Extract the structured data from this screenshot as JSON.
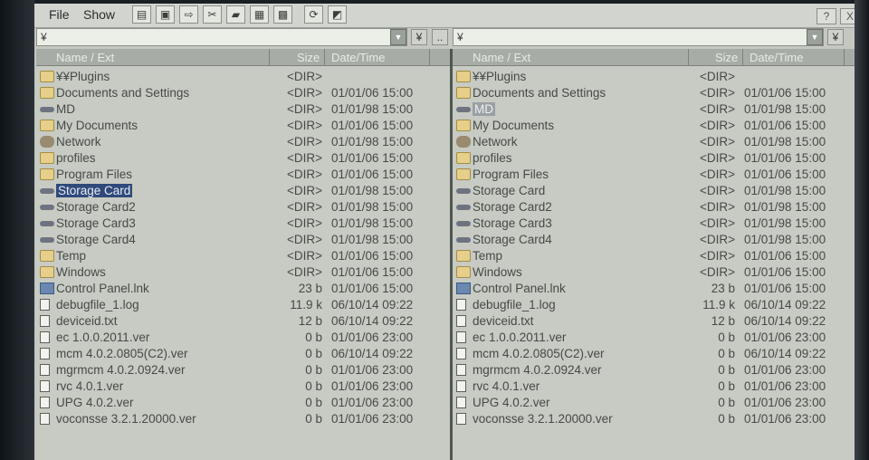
{
  "menu": {
    "file": "File",
    "show": "Show"
  },
  "toolbar_icons": [
    "view-icon",
    "properties-icon",
    "copy-icon",
    "cut-icon",
    "new-folder-icon",
    "delete-icon",
    "grid-icon",
    "refresh-icon",
    "options-icon"
  ],
  "window_buttons": {
    "help": "?",
    "close": "X"
  },
  "left_path": "¥",
  "right_path": "¥",
  "swap_label": "..",
  "yen_button": "¥",
  "columns": {
    "name": "Name / Ext",
    "size": "Size",
    "date": "Date/Time"
  },
  "left_files": [
    {
      "icon": "folder",
      "name": "¥¥Plugins",
      "size": "<DIR>",
      "date": ""
    },
    {
      "icon": "folder",
      "name": "Documents and Settings",
      "size": "<DIR>",
      "date": "01/01/06 15:00"
    },
    {
      "icon": "drive",
      "name": "MD",
      "size": "<DIR>",
      "date": "01/01/98 15:00"
    },
    {
      "icon": "folder",
      "name": "My Documents",
      "size": "<DIR>",
      "date": "01/01/06 15:00"
    },
    {
      "icon": "network",
      "name": "Network",
      "size": "<DIR>",
      "date": "01/01/98 15:00"
    },
    {
      "icon": "folder",
      "name": "profiles",
      "size": "<DIR>",
      "date": "01/01/06 15:00"
    },
    {
      "icon": "folder",
      "name": "Program Files",
      "size": "<DIR>",
      "date": "01/01/06 15:00"
    },
    {
      "icon": "drive",
      "name": "Storage Card",
      "size": "<DIR>",
      "date": "01/01/98 15:00",
      "selected": true
    },
    {
      "icon": "drive",
      "name": "Storage Card2",
      "size": "<DIR>",
      "date": "01/01/98 15:00"
    },
    {
      "icon": "drive",
      "name": "Storage Card3",
      "size": "<DIR>",
      "date": "01/01/98 15:00"
    },
    {
      "icon": "drive",
      "name": "Storage Card4",
      "size": "<DIR>",
      "date": "01/01/98 15:00"
    },
    {
      "icon": "folder",
      "name": "Temp",
      "size": "<DIR>",
      "date": "01/01/06 15:00"
    },
    {
      "icon": "folder",
      "name": "Windows",
      "size": "<DIR>",
      "date": "01/01/06 15:00"
    },
    {
      "icon": "link",
      "name": "Control Panel.lnk",
      "size": "23 b",
      "date": "01/01/06 15:00"
    },
    {
      "icon": "file",
      "name": "debugfile_1.log",
      "size": "11.9 k",
      "date": "06/10/14 09:22"
    },
    {
      "icon": "file",
      "name": "deviceid.txt",
      "size": "12 b",
      "date": "06/10/14 09:22"
    },
    {
      "icon": "file",
      "name": "ec 1.0.0.2011.ver",
      "size": "0 b",
      "date": "01/01/06 23:00"
    },
    {
      "icon": "file",
      "name": "mcm 4.0.2.0805(C2).ver",
      "size": "0 b",
      "date": "06/10/14 09:22"
    },
    {
      "icon": "file",
      "name": "mgrmcm 4.0.2.0924.ver",
      "size": "0 b",
      "date": "01/01/06 23:00"
    },
    {
      "icon": "file",
      "name": "rvc 4.0.1.ver",
      "size": "0 b",
      "date": "01/01/06 23:00"
    },
    {
      "icon": "file",
      "name": "UPG 4.0.2.ver",
      "size": "0 b",
      "date": "01/01/06 23:00"
    },
    {
      "icon": "file",
      "name": "voconsse 3.2.1.20000.ver",
      "size": "0 b",
      "date": "01/01/06 23:00"
    }
  ],
  "right_files": [
    {
      "icon": "folder",
      "name": "¥¥Plugins",
      "size": "<DIR>",
      "date": ""
    },
    {
      "icon": "folder",
      "name": "Documents and Settings",
      "size": "<DIR>",
      "date": "01/01/06 15:00"
    },
    {
      "icon": "drive",
      "name": "MD",
      "size": "<DIR>",
      "date": "01/01/98 15:00",
      "highlighted": true
    },
    {
      "icon": "folder",
      "name": "My Documents",
      "size": "<DIR>",
      "date": "01/01/06 15:00"
    },
    {
      "icon": "network",
      "name": "Network",
      "size": "<DIR>",
      "date": "01/01/98 15:00"
    },
    {
      "icon": "folder",
      "name": "profiles",
      "size": "<DIR>",
      "date": "01/01/06 15:00"
    },
    {
      "icon": "folder",
      "name": "Program Files",
      "size": "<DIR>",
      "date": "01/01/06 15:00"
    },
    {
      "icon": "drive",
      "name": "Storage Card",
      "size": "<DIR>",
      "date": "01/01/98 15:00"
    },
    {
      "icon": "drive",
      "name": "Storage Card2",
      "size": "<DIR>",
      "date": "01/01/98 15:00"
    },
    {
      "icon": "drive",
      "name": "Storage Card3",
      "size": "<DIR>",
      "date": "01/01/98 15:00"
    },
    {
      "icon": "drive",
      "name": "Storage Card4",
      "size": "<DIR>",
      "date": "01/01/98 15:00"
    },
    {
      "icon": "folder",
      "name": "Temp",
      "size": "<DIR>",
      "date": "01/01/06 15:00"
    },
    {
      "icon": "folder",
      "name": "Windows",
      "size": "<DIR>",
      "date": "01/01/06 15:00"
    },
    {
      "icon": "link",
      "name": "Control Panel.lnk",
      "size": "23 b",
      "date": "01/01/06 15:00"
    },
    {
      "icon": "file",
      "name": "debugfile_1.log",
      "size": "11.9 k",
      "date": "06/10/14 09:22"
    },
    {
      "icon": "file",
      "name": "deviceid.txt",
      "size": "12 b",
      "date": "06/10/14 09:22"
    },
    {
      "icon": "file",
      "name": "ec 1.0.0.2011.ver",
      "size": "0 b",
      "date": "01/01/06 23:00"
    },
    {
      "icon": "file",
      "name": "mcm 4.0.2.0805(C2).ver",
      "size": "0 b",
      "date": "06/10/14 09:22"
    },
    {
      "icon": "file",
      "name": "mgrmcm 4.0.2.0924.ver",
      "size": "0 b",
      "date": "01/01/06 23:00"
    },
    {
      "icon": "file",
      "name": "rvc 4.0.1.ver",
      "size": "0 b",
      "date": "01/01/06 23:00"
    },
    {
      "icon": "file",
      "name": "UPG 4.0.2.ver",
      "size": "0 b",
      "date": "01/01/06 23:00"
    },
    {
      "icon": "file",
      "name": "voconsse 3.2.1.20000.ver",
      "size": "0 b",
      "date": "01/01/06 23:00"
    }
  ]
}
